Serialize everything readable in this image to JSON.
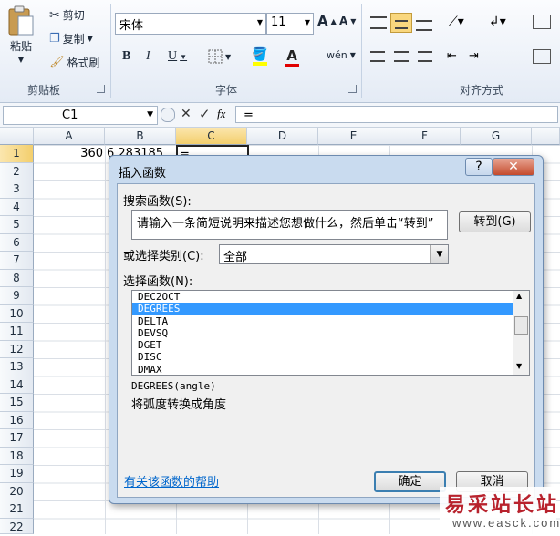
{
  "ribbon": {
    "clipboard": {
      "label": "剪贴板",
      "paste": "粘贴",
      "cut": "剪切",
      "copy": "复制",
      "format_painter": "格式刷"
    },
    "font": {
      "label": "字体",
      "font_name": "宋体",
      "font_size": "11",
      "bold": "B",
      "italic": "I",
      "underline": "U",
      "grow": "A",
      "shrink": "A",
      "phonetic": "wén"
    },
    "alignment": {
      "label": "对齐方式"
    }
  },
  "formula_bar": {
    "name_box": "C1",
    "fx": "fx",
    "content": "="
  },
  "columns": [
    "A",
    "B",
    "C",
    "D",
    "E",
    "F",
    "G"
  ],
  "rows": [
    "1",
    "2",
    "3",
    "4",
    "5",
    "6",
    "7",
    "8",
    "9",
    "10",
    "11",
    "12",
    "13",
    "14",
    "15",
    "16",
    "17",
    "18",
    "19",
    "20",
    "21",
    "22"
  ],
  "cells": {
    "A1": "360",
    "B1": "6.283185",
    "C1": "="
  },
  "dialog": {
    "title": "插入函数",
    "help_btn": "?",
    "close_btn": "✕",
    "search_label": "搜索函数(S):",
    "search_value": "请输入一条简短说明来描述您想做什么，然后单击“转到”",
    "go_button": "转到(G)",
    "category_label": "或选择类别(C):",
    "category_value": "全部",
    "select_label": "选择函数(N):",
    "functions": [
      "DEC2OCT",
      "DEGREES",
      "DELTA",
      "DEVSQ",
      "DGET",
      "DISC",
      "DMAX"
    ],
    "selected_index": 1,
    "signature": "DEGREES(angle)",
    "description": "将弧度转换成角度",
    "help_link": "有关该函数的帮助",
    "ok_button": "确定",
    "cancel_button": "取消"
  },
  "watermark": {
    "brand": "易采站长站",
    "url": "www.easck.com"
  },
  "colors": {
    "selection": "#3399ff",
    "link": "#0066cc",
    "active_header": "#f6d789"
  }
}
